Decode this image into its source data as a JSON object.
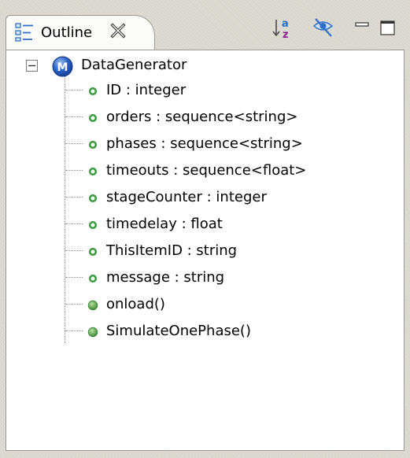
{
  "view": {
    "tab_label": "Outline",
    "colors": {
      "field_icon": "#3f9c45",
      "method_icon": "#5fa64a",
      "module_icon": "#2a61c8"
    },
    "toolbar": {
      "sort_icon": "sort-alphabetically-icon",
      "hide_icon": "hide-fields-icon",
      "minimize_icon": "minimize-icon",
      "maximize_icon": "maximize-icon"
    }
  },
  "tree": {
    "root": {
      "icon_letter": "M",
      "label": "DataGenerator",
      "expanded": true
    },
    "children": [
      {
        "kind": "field",
        "label": "ID : integer"
      },
      {
        "kind": "field",
        "label": "orders : sequence<string>"
      },
      {
        "kind": "field",
        "label": "phases : sequence<string>"
      },
      {
        "kind": "field",
        "label": "timeouts : sequence<float>"
      },
      {
        "kind": "field",
        "label": "stageCounter : integer"
      },
      {
        "kind": "field",
        "label": "timedelay : float"
      },
      {
        "kind": "field",
        "label": "ThisItemID : string"
      },
      {
        "kind": "field",
        "label": "message : string"
      },
      {
        "kind": "method",
        "label": "onload()"
      },
      {
        "kind": "method",
        "label": "SimulateOnePhase()"
      }
    ]
  }
}
